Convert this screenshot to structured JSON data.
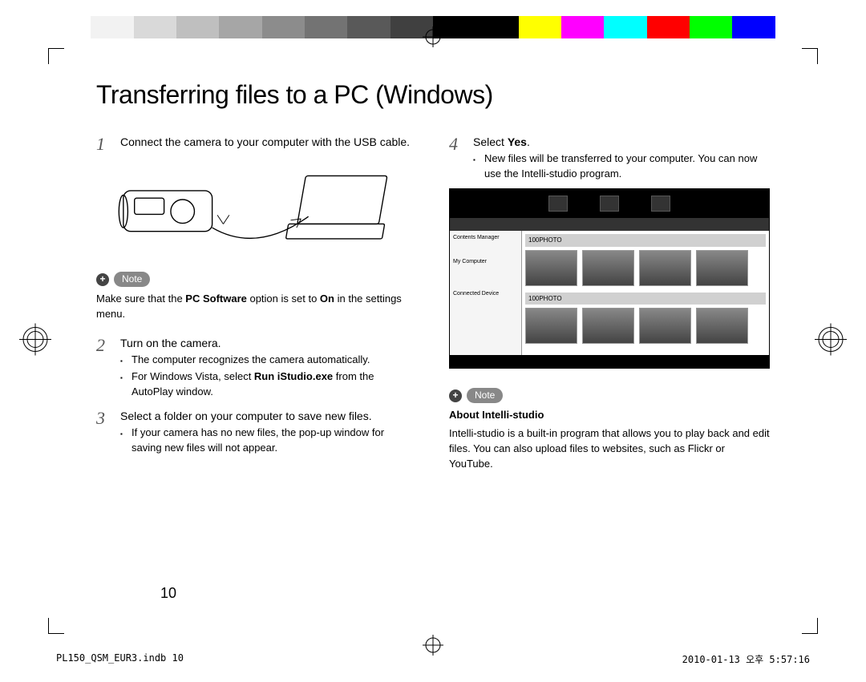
{
  "title": "Transferring files to a PC (Windows)",
  "steps": {
    "s1": {
      "num": "1",
      "text": "Connect the camera to your computer with the USB cable."
    },
    "s2": {
      "num": "2",
      "text": "Turn on the camera.",
      "bullets": {
        "b1": "The computer recognizes the camera automatically.",
        "b2a": "For Windows Vista, select ",
        "b2b": "Run iStudio.exe",
        "b2c": " from the AutoPlay window."
      }
    },
    "s3": {
      "num": "3",
      "text": "Select a folder on your computer to save new files.",
      "bullets": {
        "b1": "If your camera has no new files, the pop-up window for saving new files will not appear."
      }
    },
    "s4": {
      "num": "4",
      "text_a": "Select ",
      "text_b": "Yes",
      "text_c": ".",
      "bullets": {
        "b1": "New files will be transferred to your computer. You can now use the Intelli-studio program."
      }
    }
  },
  "notes": {
    "label": "Note",
    "n1_a": "Make sure that the ",
    "n1_b": "PC Software",
    "n1_c": " option is set to ",
    "n1_d": "On",
    "n1_e": " in the settings menu.",
    "n2_heading": "About Intelli-studio",
    "n2_body": "Intelli-studio is a built-in program that allows you to play back and edit files. You can also upload files to websites, such as Flickr or YouTube."
  },
  "screenshot_labels": {
    "folder1": "100PHOTO",
    "folder2": "100PHOTO",
    "side1": "Contents Manager",
    "side2": "My Computer",
    "side3": "Connected Device"
  },
  "page_number": "10",
  "footer": {
    "left": "PL150_QSM_EUR3.indb   10",
    "right": "2010-01-13   오후 5:57:16"
  },
  "colorbar": [
    "#fff",
    "#f2f2f2",
    "#d9d9d9",
    "#bfbfbf",
    "#a6a6a6",
    "#8c8c8c",
    "#737373",
    "#595959",
    "#404040",
    "#000",
    "#000",
    "#ffff00",
    "#ff00ff",
    "#00ffff",
    "#ff0000",
    "#00ff00",
    "#0000ff",
    "#fff"
  ]
}
